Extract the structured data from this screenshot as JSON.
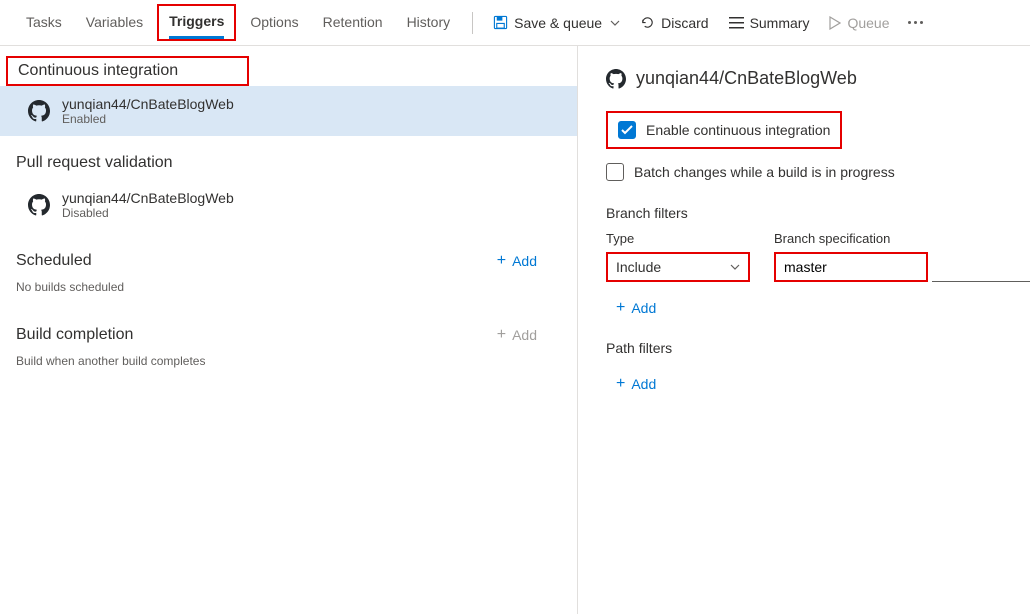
{
  "toolbar": {
    "tabs": {
      "tasks": "Tasks",
      "variables": "Variables",
      "triggers": "Triggers",
      "options": "Options",
      "retention": "Retention",
      "history": "History"
    },
    "actions": {
      "save_queue": "Save & queue",
      "discard": "Discard",
      "summary": "Summary",
      "queue": "Queue"
    }
  },
  "left": {
    "ci_title": "Continuous integration",
    "ci_repo": {
      "name": "yunqian44/CnBateBlogWeb",
      "sub": "Enabled"
    },
    "pr_title": "Pull request validation",
    "pr_repo": {
      "name": "yunqian44/CnBateBlogWeb",
      "sub": "Disabled"
    },
    "sched_title": "Scheduled",
    "sched_sub": "No builds scheduled",
    "build_title": "Build completion",
    "build_sub": "Build when another build completes",
    "add_label": "Add"
  },
  "right": {
    "repo": "yunqian44/CnBateBlogWeb",
    "enable_ci": "Enable continuous integration",
    "batch": "Batch changes while a build is in progress",
    "branch_filters_title": "Branch filters",
    "type_label": "Type",
    "branch_spec_label": "Branch specification",
    "type_value": "Include",
    "branch_value": "master",
    "path_filters_title": "Path filters",
    "add_label": "Add"
  }
}
